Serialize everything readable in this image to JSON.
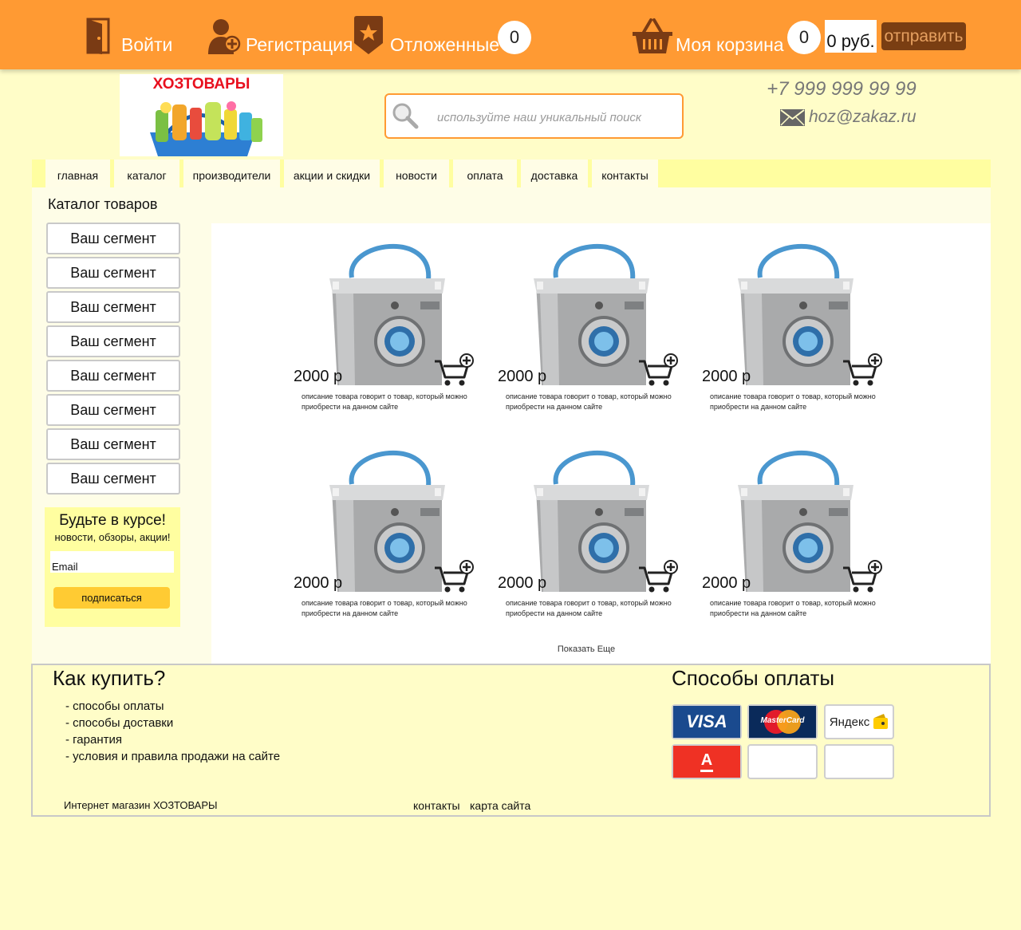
{
  "topbar": {
    "login_label": "Войти",
    "register_label": "Регистрация",
    "saved_label": "Отложенные",
    "saved_count": "0",
    "cart_label": "Моя корзина",
    "cart_count": "0",
    "cart_sum": "0 руб.",
    "send_label": "отправить"
  },
  "header": {
    "logo_text": "ХОЗТОВАРЫ",
    "search_placeholder": "используйте наш уникальный поиск",
    "phone": "+7 999 999 99 99",
    "email": "hoz@zakaz.ru"
  },
  "nav": {
    "items": [
      {
        "label": "главная"
      },
      {
        "label": "каталог"
      },
      {
        "label": "производители"
      },
      {
        "label": "акции и скидки"
      },
      {
        "label": "новости"
      },
      {
        "label": "оплата"
      },
      {
        "label": "доставка"
      },
      {
        "label": "контакты"
      }
    ]
  },
  "sidebar": {
    "title": "Каталог товаров",
    "segments": [
      {
        "label": "Ваш сегмент"
      },
      {
        "label": "Ваш сегмент"
      },
      {
        "label": "Ваш сегмент"
      },
      {
        "label": "Ваш сегмент"
      },
      {
        "label": "Ваш сегмент"
      },
      {
        "label": "Ваш сегмент"
      },
      {
        "label": "Ваш сегмент"
      },
      {
        "label": "Ваш сегмент"
      }
    ],
    "newsletter": {
      "title": "Будьте в курсе!",
      "subtitle": "новости, обзоры, акции!",
      "email_placeholder": "Email",
      "button_label": "подписаться"
    }
  },
  "products": [
    {
      "price": "2000 р",
      "description": "описание товара говорит о товар, который можно приобрести на данном сайте"
    },
    {
      "price": "2000 р",
      "description": "описание товара говорит о товар, который можно приобрести на данном сайте"
    },
    {
      "price": "2000 р",
      "description": "описание товара говорит о товар, который можно приобрести на данном сайте"
    },
    {
      "price": "2000 р",
      "description": "описание товара говорит о товар, который можно приобрести на данном сайте"
    },
    {
      "price": "2000 р",
      "description": "описание товара говорит о товар, который можно приобрести на данном сайте"
    },
    {
      "price": "2000 р",
      "description": "описание товара говорит о товар, который можно приобрести на данном сайте"
    }
  ],
  "show_more_label": "Показать Еще",
  "footer": {
    "how_to_buy_title": "Как купить?",
    "links": [
      {
        "label": "- способы оплаты"
      },
      {
        "label": "- способы доставки"
      },
      {
        "label": "- гарантия"
      },
      {
        "label": "- условия и правила продажи на сайте"
      }
    ],
    "payment_title": "Способы оплаты",
    "payment_methods": [
      {
        "label": "VISA",
        "icon": "visa-icon"
      },
      {
        "label": "MasterCard",
        "icon": "mastercard-icon"
      },
      {
        "label": "Яндекс",
        "icon": "yandex-money-icon"
      },
      {
        "label": "А",
        "icon": "alfa-bank-icon"
      }
    ],
    "shop_name": "Интернет магазин ХОЗТОВАРЫ",
    "contacts_label": "контакты",
    "sitemap_label": "карта сайта"
  },
  "colors": {
    "topbar": "#ff9a33",
    "page_bg": "#fffdc8",
    "nav_bg": "#fffea0",
    "accent_dark": "#7a3e12",
    "subscribe_button": "#ffcb33"
  }
}
